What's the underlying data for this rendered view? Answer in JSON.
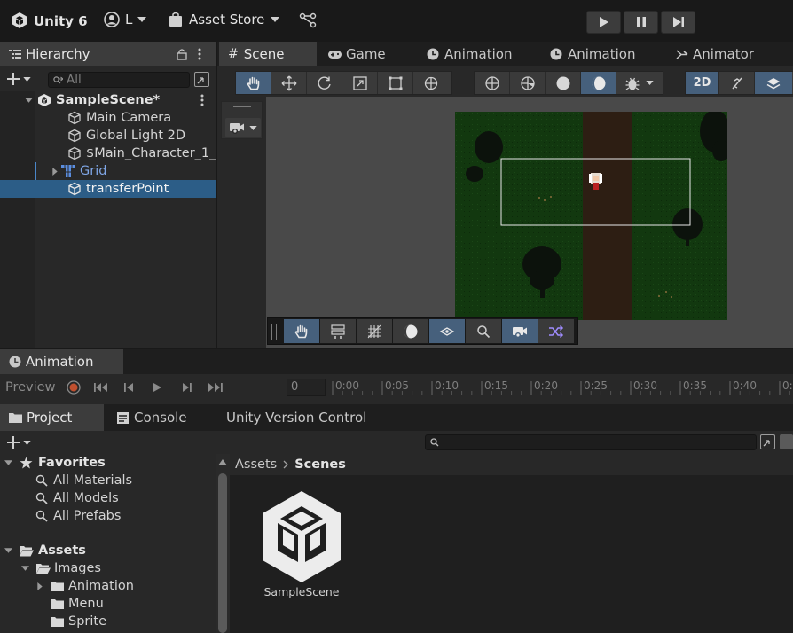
{
  "topbar": {
    "app": "Unity 6",
    "account": "L",
    "asset_store": "Asset Store"
  },
  "hierarchy": {
    "tab": "Hierarchy",
    "search_placeholder": "All",
    "scene": "SampleScene*",
    "items": [
      "Main Camera",
      "Global Light 2D",
      "$Main_Character_1_",
      "Grid",
      "transferPoint"
    ]
  },
  "scene_tabs": [
    "Scene",
    "Game",
    "Animation",
    "Animation",
    "Animator"
  ],
  "scene_toolbar": {
    "mode_2d": "2D"
  },
  "animation": {
    "tab": "Animation",
    "preview": "Preview",
    "frame": "0",
    "ticks": [
      "0:00",
      "0:05",
      "0:10",
      "0:15",
      "0:20",
      "0:25",
      "0:30",
      "0:35",
      "0:40",
      "0:4"
    ]
  },
  "project": {
    "tabs": [
      "Project",
      "Console",
      "Unity Version Control"
    ],
    "favorites": "Favorites",
    "fav_items": [
      "All Materials",
      "All Models",
      "All Prefabs"
    ],
    "assets": "Assets",
    "images": "Images",
    "folders": [
      "Animation",
      "Menu",
      "Sprite"
    ],
    "breadcrumb": [
      "Assets",
      "Scenes"
    ],
    "asset_label": "SampleScene"
  }
}
